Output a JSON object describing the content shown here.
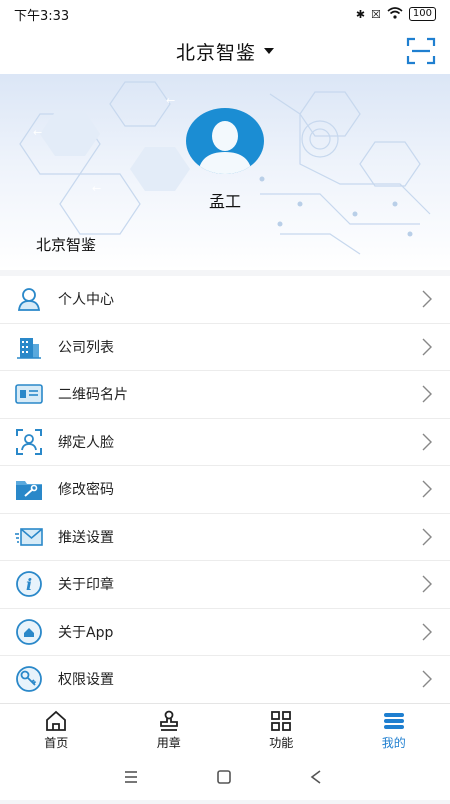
{
  "status": {
    "time": "下午3:33",
    "battery": "100"
  },
  "header": {
    "title": "北京智鉴",
    "scan_icon": "scan-icon"
  },
  "profile": {
    "name": "孟工",
    "company": "北京智鉴"
  },
  "menu": {
    "items": [
      {
        "label": "个人中心",
        "icon": "user-icon"
      },
      {
        "label": "公司列表",
        "icon": "building-icon"
      },
      {
        "label": "二维码名片",
        "icon": "card-icon"
      },
      {
        "label": "绑定人脸",
        "icon": "face-icon"
      },
      {
        "label": "修改密码",
        "icon": "folder-key-icon"
      },
      {
        "label": "推送设置",
        "icon": "mail-icon"
      },
      {
        "label": "关于印章",
        "icon": "info-icon"
      },
      {
        "label": "关于App",
        "icon": "home-circle-icon"
      },
      {
        "label": "权限设置",
        "icon": "key-icon"
      }
    ]
  },
  "tabbar": {
    "tabs": [
      {
        "label": "首页",
        "icon": "home-icon",
        "active": false
      },
      {
        "label": "用章",
        "icon": "stamp-icon",
        "active": false
      },
      {
        "label": "功能",
        "icon": "grid-icon",
        "active": false
      },
      {
        "label": "我的",
        "icon": "profile-icon",
        "active": true
      }
    ]
  },
  "colors": {
    "accent": "#1f7fd0",
    "avatar_bg": "#1b8dd3"
  }
}
